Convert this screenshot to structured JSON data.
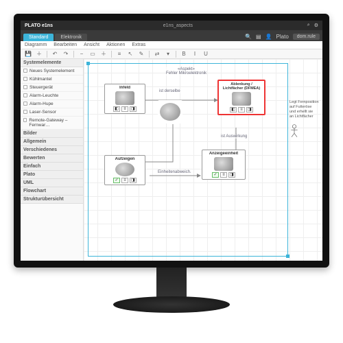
{
  "titlebar": {
    "product": "PLATO e1ns",
    "doc": "e1ns_aspects"
  },
  "tabs": {
    "active": "Standard",
    "inactive": "Elektronik"
  },
  "topright": {
    "user": "Plato",
    "btn": "dom.rule"
  },
  "menubar": [
    "Diagramm",
    "Bearbeiten",
    "Ansicht",
    "Aktionen",
    "Extras"
  ],
  "sidebar": {
    "cat1": "Systemelemente",
    "items1": [
      "Neues Systemelement",
      "Kühlmantel",
      "Steuergerät",
      "Alarm-Leuchte",
      "Alarm-Hupe",
      "Laser-Sensor",
      "Remote-Gateway – Fernwar…"
    ],
    "cats2": [
      "Bilder",
      "Allgemein",
      "Verschiedenes",
      "Bewerten",
      "Einfach",
      "Plato",
      "UML",
      "Flowchart",
      "Strukturübersicht"
    ]
  },
  "canvas": {
    "toplabel": "«Aspekt»\nFehler Mikroelektronik",
    "nodes": {
      "infeld": {
        "title": "Infeld"
      },
      "ablenkung": {
        "title": "Ablenkung / Lichtfächer (DFMEA)"
      },
      "aufzeigen": {
        "title": "Aufzeigen"
      },
      "anzeige": {
        "title": "Anzeigeeinheit"
      }
    },
    "edges": {
      "e1": "ist derselbe",
      "e2": "ist Auswirkung",
      "e3": "Einheitenabweich."
    },
    "notes": [
      "Legt Fernposition",
      "auf Futteröse",
      "und erhellt sie",
      "an Lichtfächer"
    ]
  }
}
